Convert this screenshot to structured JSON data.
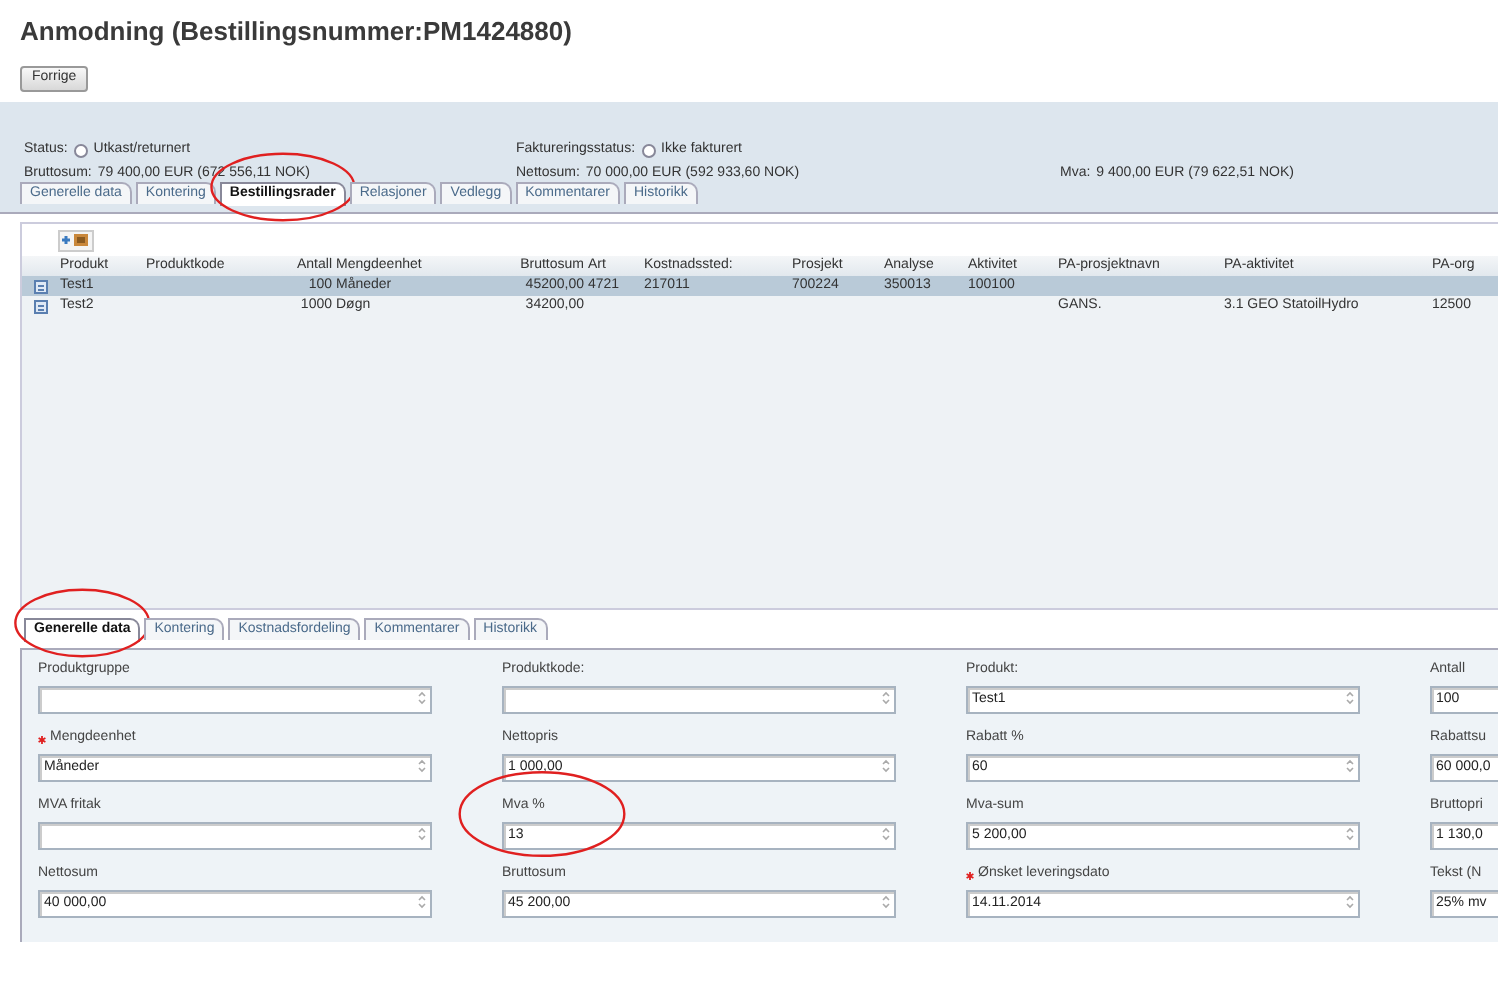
{
  "title": "Anmodning (Bestillingsnummer:PM1424880)",
  "back_button": "Forrige",
  "summary": [
    [
      {
        "label": "Status:",
        "value": "Utkast/returnert",
        "kind": "status",
        "checked": false
      },
      {
        "label": "Faktureringsstatus:",
        "value": "Ikke fakturert",
        "kind": "status",
        "checked": false
      }
    ],
    [
      {
        "label": "Bruttosum:",
        "value": "79 400,00 EUR (672 556,11 NOK)",
        "kind": "amount"
      },
      {
        "label": "Nettosum:",
        "value": "70 000,00 EUR (592 933,60 NOK)",
        "kind": "amount"
      },
      {
        "label": "Mva:",
        "value": "9 400,00 EUR (79 622,51 NOK)",
        "kind": "amount"
      }
    ]
  ],
  "top_tabs": [
    {
      "label": "Generelle data",
      "selected": false,
      "circled": false
    },
    {
      "label": "Kontering",
      "selected": false,
      "circled": false
    },
    {
      "label": "Bestillingsrader",
      "selected": true,
      "circled": true
    },
    {
      "label": "Relasjoner",
      "selected": false,
      "circled": false
    },
    {
      "label": "Vedlegg",
      "selected": false,
      "circled": false
    },
    {
      "label": "Kommentarer",
      "selected": false,
      "circled": false
    },
    {
      "label": "Historikk",
      "selected": false,
      "circled": false
    }
  ],
  "table": {
    "columns": [
      "Produkt",
      "Produktkode",
      "Antall",
      "Mengdeenhet",
      "Bruttosum",
      "Art",
      "Kostnadssted:",
      "Prosjekt",
      "Analyse",
      "Aktivitet",
      "PA-prosjektnavn",
      "PA-aktivitet",
      "PA-org"
    ],
    "rows": [
      {
        "selected": true,
        "cells": [
          "Test1",
          null,
          "100",
          "Måneder",
          "45200,00",
          "4721",
          "217011",
          "700224",
          "350013",
          "100100",
          null,
          null,
          null
        ]
      },
      {
        "selected": false,
        "cells": [
          "Test2",
          null,
          "1000",
          "Døgn",
          "34200,00",
          null,
          null,
          null,
          null,
          null,
          "GANS.",
          "3.1 GEO StatoilHydro",
          "12500"
        ]
      }
    ]
  },
  "detail_tabs": [
    {
      "label": "Generelle data",
      "selected": true,
      "circled": true
    },
    {
      "label": "Kontering",
      "selected": false,
      "circled": false
    },
    {
      "label": "Kostnadsfordeling",
      "selected": false,
      "circled": false
    },
    {
      "label": "Kommentarer",
      "selected": false,
      "circled": false
    },
    {
      "label": "Historikk",
      "selected": false,
      "circled": false
    }
  ],
  "fields": [
    {
      "label": "Produktgruppe",
      "required": false,
      "circled": false
    },
    {
      "label": "Produktkode:",
      "required": false,
      "circled": false
    },
    {
      "label": "Produkt:",
      "value": "Test1",
      "required": false,
      "circled": false
    },
    {
      "label": "Antall",
      "value": "100",
      "required": false,
      "circled": false
    },
    {
      "label": "Mengdeenhet",
      "value": "Måneder",
      "required": true,
      "circled": false
    },
    {
      "label": "Nettopris",
      "value": "1 000,00",
      "required": false,
      "circled": false
    },
    {
      "label": "Rabatt %",
      "value": "60",
      "required": false,
      "circled": false
    },
    {
      "label": "Rabattsu",
      "value": "60 000,0",
      "required": false,
      "circled": false
    },
    {
      "label": "MVA fritak",
      "required": false,
      "circled": false
    },
    {
      "label": "Mva %",
      "value": "13",
      "required": false,
      "circled": true
    },
    {
      "label": "Mva-sum",
      "value": "5 200,00",
      "required": false,
      "circled": false
    },
    {
      "label": "Bruttopri",
      "value": "1 130,0",
      "required": false,
      "circled": false
    },
    {
      "label": "Nettosum",
      "value": "40 000,00",
      "required": false,
      "circled": false
    },
    {
      "label": "Bruttosum",
      "value": "45 200,00",
      "required": false,
      "circled": false
    },
    {
      "label": "Ønsket leveringsdato",
      "value": "14.11.2014",
      "required": true,
      "circled": false
    },
    {
      "label": "Tekst (N",
      "value": "25% mv",
      "required": false,
      "circled": false
    }
  ]
}
